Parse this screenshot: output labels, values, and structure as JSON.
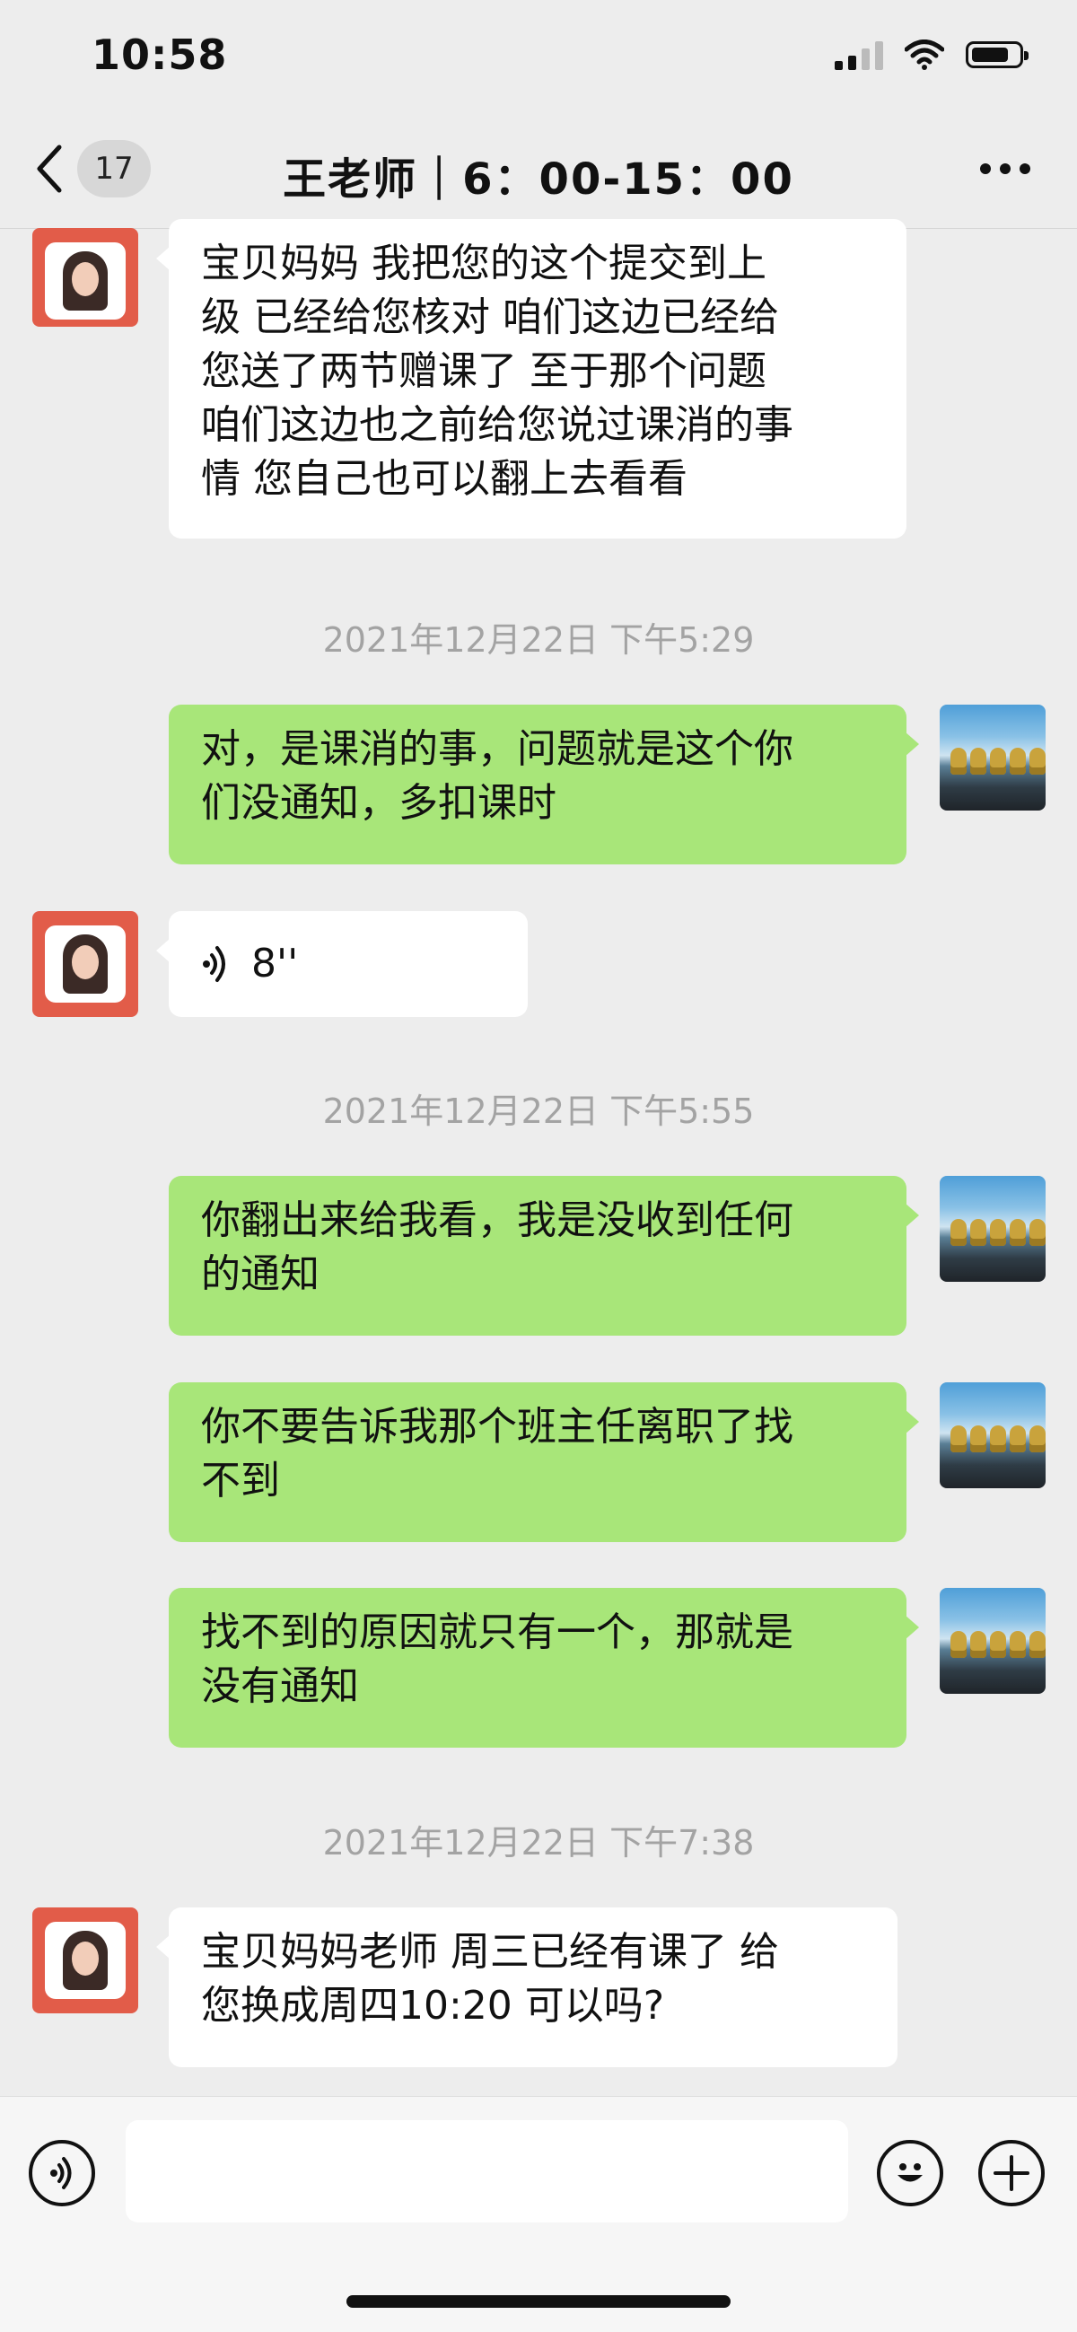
{
  "status": {
    "time": "10:58"
  },
  "nav": {
    "back_badge": "17",
    "title": "王老师｜6：00-15：00"
  },
  "messages": [
    {
      "side": "left",
      "type": "text",
      "text": " 宝贝妈妈  我把您的这个提交到上\n级 已经给您核对 咱们这边已经给\n您送了两节赠课了  至于那个问题\n咱们这边也之前给您说过课消的事\n情  您自己也可以翻上去看看"
    },
    {
      "timestamp": "2021年12月22日 下午5:29"
    },
    {
      "side": "right",
      "type": "text",
      "text": "对，是课消的事，问题就是这个你\n们没通知，多扣课时"
    },
    {
      "side": "left",
      "type": "voice",
      "duration": "8''"
    },
    {
      "timestamp": "2021年12月22日 下午5:55"
    },
    {
      "side": "right",
      "type": "text",
      "text": "你翻出来给我看，我是没收到任何\n的通知"
    },
    {
      "side": "right",
      "type": "text",
      "text": "你不要告诉我那个班主任离职了找\n不到"
    },
    {
      "side": "right",
      "type": "text",
      "text": "找不到的原因就只有一个，那就是\n没有通知"
    },
    {
      "timestamp": "2021年12月22日 下午7:38"
    },
    {
      "side": "left",
      "type": "text",
      "text": "宝贝妈妈老师 周三已经有课了  给\n您换成周四10:20 可以吗?"
    }
  ],
  "colors": {
    "bg": "#ededed",
    "bubble_me": "#a8e679",
    "bubble_other": "#ffffff",
    "timestamp": "#a3a3a3"
  },
  "icons": {
    "back": "chevron-left-icon",
    "more": "more-dots-icon",
    "voice": "voice-icon",
    "emoji": "emoji-icon",
    "plus": "plus-icon"
  }
}
